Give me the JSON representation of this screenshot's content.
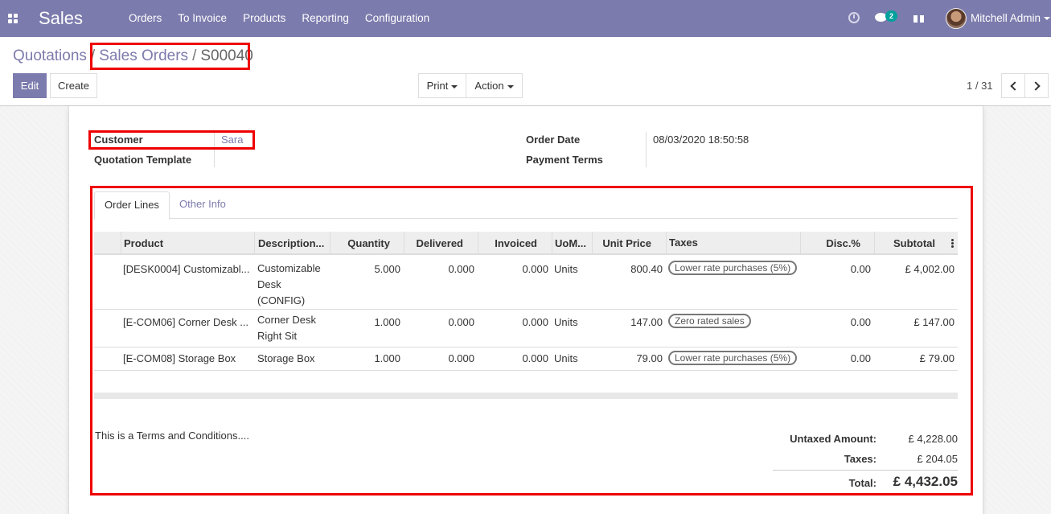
{
  "nav": {
    "brand": "Sales",
    "menu": [
      "Orders",
      "To Invoice",
      "Products",
      "Reporting",
      "Configuration"
    ],
    "chat_count": "2",
    "user": "Mitchell Admin"
  },
  "breadcrumb": {
    "root": "Quotations",
    "parent": "Sales Orders",
    "current": "S00040"
  },
  "buttons": {
    "edit": "Edit",
    "create": "Create",
    "print": "Print",
    "action": "Action"
  },
  "pager": "1 / 31",
  "form": {
    "customer_label": "Customer",
    "customer_value": "Sara",
    "template_label": "Quotation Template",
    "order_date_label": "Order Date",
    "order_date_value": "08/03/2020 18:50:58",
    "payment_terms_label": "Payment Terms"
  },
  "tabs": [
    "Order Lines",
    "Other Info"
  ],
  "columns": [
    "Product",
    "Description...",
    "Quantity",
    "Delivered",
    "Invoiced",
    "UoM...",
    "Unit Price",
    "Taxes",
    "Disc.%",
    "Subtotal"
  ],
  "lines": [
    {
      "product": "[DESK0004] Customizabl...",
      "description": [
        "Customizable",
        "Desk",
        "(CONFIG)"
      ],
      "quantity": "5.000",
      "delivered": "0.000",
      "invoiced": "0.000",
      "uom": "Units",
      "unit_price": "800.40",
      "tax": "Lower rate purchases (5%)",
      "discount": "0.00",
      "subtotal": "£ 4,002.00"
    },
    {
      "product": "[E-COM06] Corner Desk ...",
      "description": [
        "Corner Desk",
        "Right Sit"
      ],
      "quantity": "1.000",
      "delivered": "0.000",
      "invoiced": "0.000",
      "uom": "Units",
      "unit_price": "147.00",
      "tax": "Zero rated sales",
      "discount": "0.00",
      "subtotal": "£ 147.00"
    },
    {
      "product": "[E-COM08] Storage Box",
      "description": [
        "Storage Box"
      ],
      "quantity": "1.000",
      "delivered": "0.000",
      "invoiced": "0.000",
      "uom": "Units",
      "unit_price": "79.00",
      "tax": "Lower rate purchases (5%)",
      "discount": "0.00",
      "subtotal": "£ 79.00"
    }
  ],
  "terms": "This is a Terms and Conditions....",
  "totals": {
    "untaxed_label": "Untaxed Amount:",
    "untaxed_value": "£ 4,228.00",
    "taxes_label": "Taxes:",
    "taxes_value": "£ 204.05",
    "total_label": "Total:",
    "total_value": "£ 4,432.05"
  },
  "colors": {
    "brand": "#7c7bad",
    "highlight": "#e00000"
  }
}
